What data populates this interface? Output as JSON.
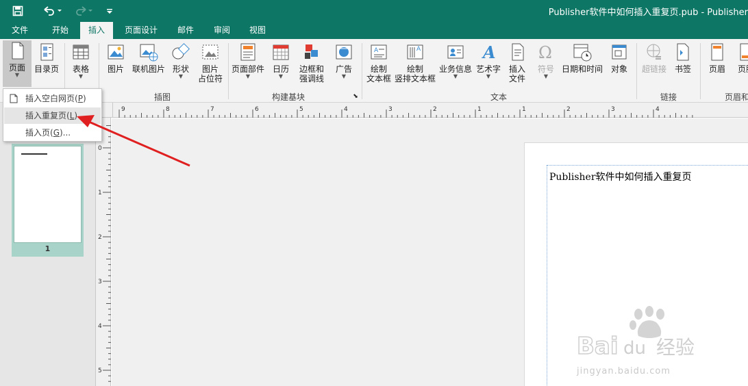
{
  "title": "Publisher软件中如何插入重复页.pub - Publisher",
  "tabs": [
    "文件",
    "开始",
    "插入",
    "页面设计",
    "邮件",
    "审阅",
    "视图"
  ],
  "active_tab": "插入",
  "ribbon": {
    "page": "页面",
    "catalog_page": "目录页",
    "table": "表格",
    "picture": "图片",
    "online_picture": "联机图片",
    "shapes": "形状",
    "placeholder_l1": "图片",
    "placeholder_l2": "占位符",
    "page_parts": "页面部件",
    "calendar": "日历",
    "borders_l1": "边框和",
    "borders_l2": "强调线",
    "ad": "广告",
    "draw_textbox_l1": "绘制",
    "draw_textbox_l2": "文本框",
    "draw_vtextbox_l1": "绘制",
    "draw_vtextbox_l2": "竖排文本框",
    "business_info": "业务信息",
    "wordart": "艺术字",
    "insert_file_l1": "插入",
    "insert_file_l2": "文件",
    "symbol": "符号",
    "datetime": "日期和时间",
    "object": "对象",
    "hyperlink": "超链接",
    "bookmark": "书签",
    "header": "页眉",
    "footer": "页脚",
    "groups": {
      "illustrations": "插图",
      "building_blocks": "构建基块",
      "text": "文本",
      "links": "链接",
      "header_footer": "页眉和"
    }
  },
  "dropdown": {
    "insert_blank_l": "插入空白网页(",
    "insert_blank_k": "P",
    "insert_dup_l": "插入重复页(",
    "insert_dup_k": "L",
    "insert_page_l": "插入页(",
    "insert_page_k": "G",
    "insert_page_tail": ")...",
    "close": ")"
  },
  "thumbnail": {
    "page_number": "1"
  },
  "page_text": "Publisher软件中如何插入重复页",
  "rulers": {
    "h": [
      "9",
      "8",
      "7",
      "6",
      "5",
      "4",
      "3",
      "2",
      "1",
      "1",
      "2",
      "3",
      "4"
    ],
    "v": [
      "0",
      "1",
      "2",
      "3",
      "4",
      "5"
    ]
  },
  "watermark": {
    "brand": "Bai",
    "brand2": "du",
    "cn": "经验",
    "url": "jingyan.baidu.com"
  },
  "colors": {
    "accent": "#0e7665",
    "arrow": "#e02020"
  }
}
